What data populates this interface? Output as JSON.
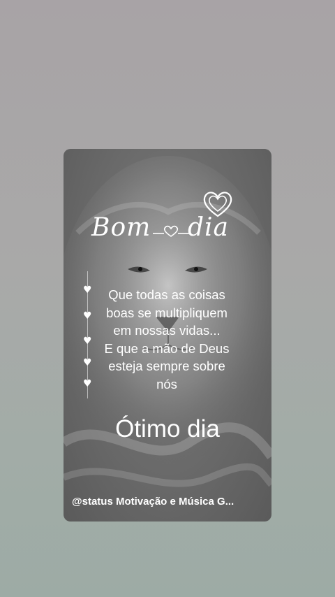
{
  "card": {
    "greeting_word1": "Bom",
    "greeting_word2": "dia",
    "quote_lines": [
      "Que todas as coisas",
      "boas se multipliquem",
      "em nossas vidas...",
      "E que a mão de Deus",
      "esteja sempre sobre",
      "nós"
    ],
    "closing": "Ótimo dia",
    "footer": "@status Motivação e Música G..."
  },
  "icons": {
    "top": "double-heart-outline-icon",
    "bullets": "heart-icon",
    "divider": "heart-icon"
  },
  "colors": {
    "background_top": "#a8a3a6",
    "background_bottom": "#9daba5",
    "card": "#6f6f6f",
    "text": "#ffffff"
  }
}
